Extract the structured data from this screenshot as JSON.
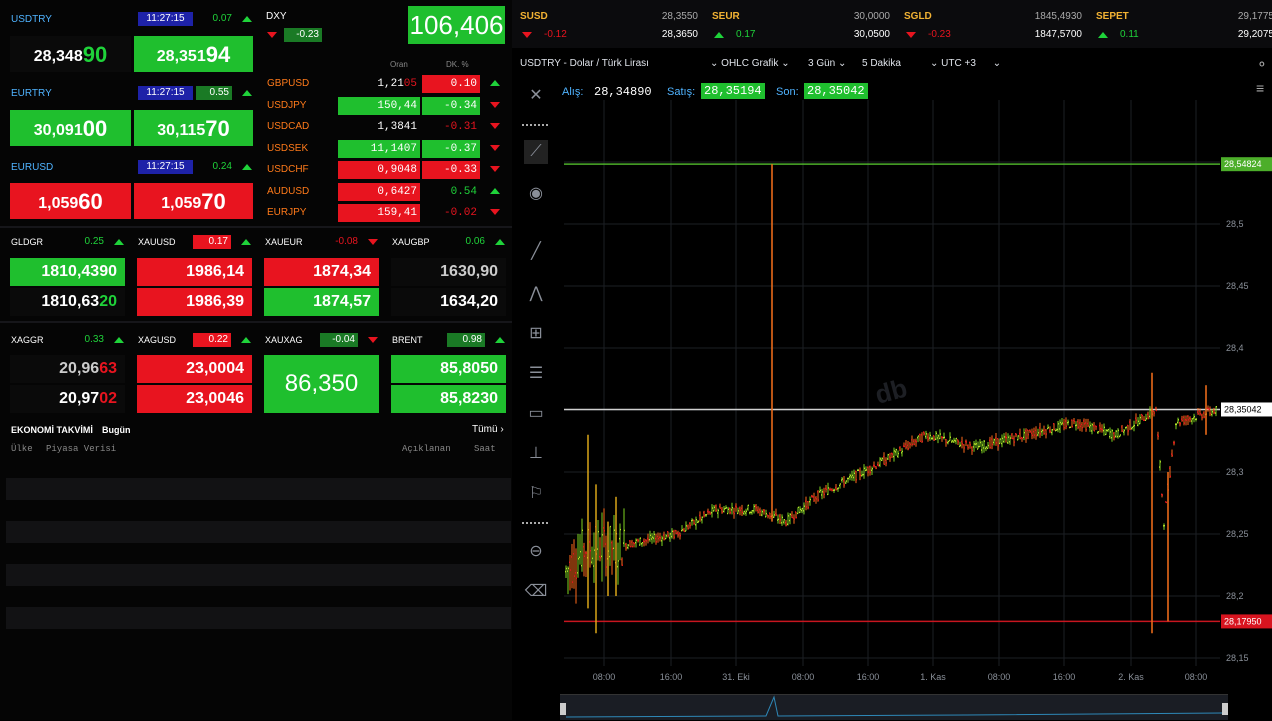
{
  "colors": {
    "up": "#1fbf2e",
    "down": "#e8141f",
    "timestamp_bg": "#1e22a8",
    "accent_blue": "#4fb3ff"
  },
  "quotes": [
    {
      "name": "USDTRY",
      "time": "11:27:15",
      "change": "0.07",
      "dir": "up",
      "bid_s": "28,348",
      "bid_b": "90",
      "ask_s": "28,351",
      "ask_b": "94"
    },
    {
      "name": "EURTRY",
      "time": "11:27:15",
      "change": "0.55",
      "dir": "up",
      "bid_s": "30,091",
      "bid_b": "00",
      "ask_s": "30,115",
      "ask_b": "70"
    },
    {
      "name": "EURUSD",
      "time": "11:27:15",
      "change": "0.24",
      "dir": "up",
      "bid_s": "1,059",
      "bid_b": "60",
      "ask_s": "1,059",
      "ask_b": "70"
    }
  ],
  "dxy": {
    "name": "DXY",
    "change": "-0.23",
    "value": "106,406"
  },
  "fx_header": {
    "oran": "Oran",
    "dk": "DK. %"
  },
  "fx_table": [
    {
      "name": "GBPUSD",
      "rate": "1,21",
      "rate_tail": "05",
      "change": "0.10",
      "rate_bg": "none",
      "chg_bg": "red",
      "dir": "up"
    },
    {
      "name": "USDJPY",
      "rate": "150,44",
      "rate_tail": "",
      "change": "-0.34",
      "rate_bg": "green",
      "chg_bg": "green",
      "dir": "dn"
    },
    {
      "name": "USDCAD",
      "rate": "1,3841",
      "rate_tail": "",
      "change": "-0.31",
      "rate_bg": "none",
      "chg_bg": "none",
      "dir": "dn"
    },
    {
      "name": "USDSEK",
      "rate": "11,1407",
      "rate_tail": "",
      "change": "-0.37",
      "rate_bg": "green",
      "chg_bg": "green",
      "dir": "dn"
    },
    {
      "name": "USDCHF",
      "rate": "0,9048",
      "rate_tail": "",
      "change": "-0.33",
      "rate_bg": "red",
      "chg_bg": "red",
      "dir": "dn"
    },
    {
      "name": "AUDUSD",
      "rate": "0,6427",
      "rate_tail": "",
      "change": "0.54",
      "rate_bg": "red",
      "chg_bg": "none",
      "dir": "up"
    },
    {
      "name": "EURJPY",
      "rate": "159,41",
      "rate_tail": "",
      "change": "-0.02",
      "rate_bg": "red",
      "chg_bg": "none",
      "dir": "dn"
    }
  ],
  "metals": [
    {
      "name": "GLDGR",
      "change": "0.25",
      "dir": "up",
      "v1": "1810,4390",
      "v2": "1810,63",
      "v2_tail": "20",
      "bg1": "green",
      "bg2": "black"
    },
    {
      "name": "XAUUSD",
      "change": "0.17",
      "dir": "up",
      "v1": "1986,14",
      "v2": "1986,39",
      "v2_tail": "",
      "bg1": "red",
      "bg2": "red"
    },
    {
      "name": "XAUEUR",
      "change": "-0.08",
      "dir": "dn",
      "v1": "1874,34",
      "v2": "1874,57",
      "v2_tail": "",
      "bg1": "red",
      "bg2": "green"
    },
    {
      "name": "XAUGBP",
      "change": "0.06",
      "dir": "up",
      "v1": "1630,90",
      "v2": "1634,20",
      "v2_tail": "",
      "bg1": "black",
      "bg2": "black"
    }
  ],
  "silver": [
    {
      "name": "XAGGR",
      "change": "0.33",
      "dir": "up",
      "v1": "20,96",
      "v1_tail": "63",
      "v2": "20,97",
      "v2_tail": "02"
    },
    {
      "name": "XAGUSD",
      "change": "0.22",
      "dir": "up",
      "v1": "23,0004",
      "v2": "23,0046"
    },
    {
      "name": "XAUXAG",
      "change": "-0.04",
      "dir": "dn",
      "single": "86,350"
    },
    {
      "name": "BRENT",
      "change": "0.98",
      "dir": "up",
      "v1": "85,8050",
      "v2": "85,8230"
    }
  ],
  "calendar": {
    "title": "EKONOMİ TAKVİMİ",
    "subtitle": "Bugün",
    "all": "Tümü",
    "cols": [
      "Ülke",
      "Piyasa Verisi",
      "Açıklanan",
      "Saat"
    ]
  },
  "top_strip": [
    {
      "name": "SUSD",
      "change": "-0.12",
      "dir": "dn",
      "v1": "28,3550",
      "v2": "28,3650"
    },
    {
      "name": "SEUR",
      "change": "0.17",
      "dir": "up",
      "v1": "30,0000",
      "v2": "30,0500"
    },
    {
      "name": "SGLD",
      "change": "-0.23",
      "dir": "dn",
      "v1": "1845,4930",
      "v2": "1847,5700"
    },
    {
      "name": "SEPET",
      "change": "0.11",
      "dir": "up",
      "v1": "29,1775",
      "v2": "29,2075"
    }
  ],
  "chart_toolbar": {
    "symbol": "USDTRY - Dolar / Türk Lirası",
    "type": "OHLC Grafik",
    "range": "3 Gün",
    "interval": "5 Dakika",
    "tz": "UTC +3"
  },
  "chart_legend": {
    "bid_label": "Alış:",
    "bid": "28,34890",
    "ask_label": "Satış:",
    "ask": "28,35194",
    "last_label": "Son:",
    "last": "28,35042"
  },
  "price_labels": {
    "top": "28,54824",
    "current": "28,35042",
    "bottom": "28,17950"
  },
  "y_ticks": [
    "28,55",
    "28,5",
    "28,45",
    "28,4",
    "28,35",
    "28,3",
    "28,25",
    "28,2",
    "28,15"
  ],
  "x_ticks": [
    "08:00",
    "16:00",
    "31. Eki",
    "08:00",
    "16:00",
    "1. Kas",
    "08:00",
    "16:00",
    "2. Kas",
    "08:00"
  ],
  "watermark": "db"
}
